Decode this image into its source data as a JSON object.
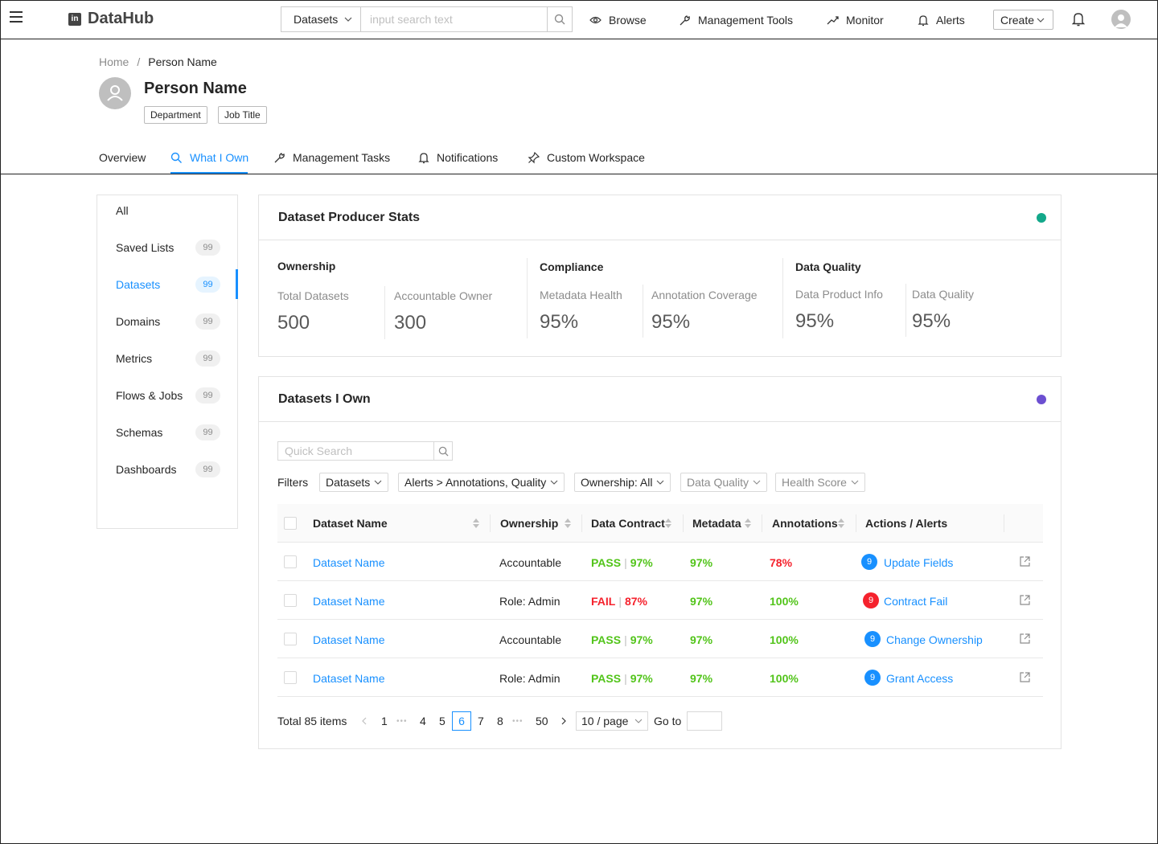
{
  "app": {
    "name": "DataHub",
    "logo_mark": "in"
  },
  "topnav": {
    "search_type": "Datasets",
    "search_placeholder": "input search text",
    "browse": "Browse",
    "management_tools": "Management Tools",
    "monitor": "Monitor",
    "alerts": "Alerts",
    "create": "Create"
  },
  "breadcrumb": {
    "home": "Home",
    "sep": "/",
    "current": "Person Name"
  },
  "profile": {
    "name": "Person Name",
    "department": "Department",
    "job_title": "Job Title"
  },
  "tabs": {
    "overview": "Overview",
    "what_i_own": "What I Own",
    "management_tasks": "Management Tasks",
    "notifications": "Notifications",
    "custom_workspace": "Custom Workspace"
  },
  "sidebar": {
    "items": [
      {
        "label": "All",
        "count": ""
      },
      {
        "label": "Saved Lists",
        "count": "99"
      },
      {
        "label": "Datasets",
        "count": "99"
      },
      {
        "label": "Domains",
        "count": "99"
      },
      {
        "label": "Metrics",
        "count": "99"
      },
      {
        "label": "Flows & Jobs",
        "count": "99"
      },
      {
        "label": "Schemas",
        "count": "99"
      },
      {
        "label": "Dashboards",
        "count": "99"
      }
    ]
  },
  "stats_card": {
    "title": "Dataset Producer Stats",
    "dot_color": "#13a88a",
    "groups": [
      {
        "title": "Ownership",
        "stats": [
          {
            "label": "Total Datasets",
            "value": "500"
          },
          {
            "label": "Accountable Owner",
            "value": "300"
          }
        ]
      },
      {
        "title": "Compliance",
        "stats": [
          {
            "label": "Metadata Health",
            "value": "95%"
          },
          {
            "label": "Annotation Coverage",
            "value": "95%"
          }
        ]
      },
      {
        "title": "Data Quality",
        "stats": [
          {
            "label": "Data Product Info",
            "value": "95%"
          },
          {
            "label": "Data Quality",
            "value": "95%"
          }
        ]
      }
    ]
  },
  "datasets_card": {
    "title": "Datasets I Own",
    "dot_color": "#6c4fd1",
    "quick_search_placeholder": "Quick Search",
    "filters_label": "Filters",
    "filters": [
      {
        "label": "Datasets"
      },
      {
        "label": "Alerts > Annotations, Quality"
      },
      {
        "label": "Ownership: All"
      },
      {
        "label": "Data Quality"
      },
      {
        "label": "Health Score"
      }
    ],
    "columns": {
      "name": "Dataset Name",
      "ownership": "Ownership",
      "contract": "Data Contract",
      "metadata": "Metadata",
      "annotations": "Annotations",
      "actions": "Actions / Alerts"
    },
    "rows": [
      {
        "name": "Dataset Name",
        "ownership": "Accountable",
        "contract_status": "PASS",
        "contract_pct": "97%",
        "metadata": "97%",
        "annotations": "78%",
        "alert_count": "9",
        "action": "Update Fields"
      },
      {
        "name": "Dataset Name",
        "ownership": "Role: Admin",
        "contract_status": "FAIL",
        "contract_pct": "87%",
        "metadata": "97%",
        "annotations": "100%",
        "alert_count": "9",
        "action": "Contract Fail"
      },
      {
        "name": "Dataset Name",
        "ownership": "Accountable",
        "contract_status": "PASS",
        "contract_pct": "97%",
        "metadata": "97%",
        "annotations": "100%",
        "alert_count": "9",
        "action": "Change Ownership"
      },
      {
        "name": "Dataset Name",
        "ownership": "Role: Admin",
        "contract_status": "PASS",
        "contract_pct": "97%",
        "metadata": "97%",
        "annotations": "100%",
        "alert_count": "9",
        "action": "Grant Access"
      }
    ],
    "colors": {
      "pass": "#52c41a",
      "fail": "#f5222d",
      "badge_blue": "#1890ff",
      "badge_red": "#f5222d"
    },
    "pagination": {
      "total": "Total 85 items",
      "pages": [
        "1",
        "4",
        "5",
        "6",
        "7",
        "8",
        "50"
      ],
      "current": "6",
      "ellipsis": "•••",
      "page_size": "10 / page",
      "goto": "Go to"
    }
  }
}
